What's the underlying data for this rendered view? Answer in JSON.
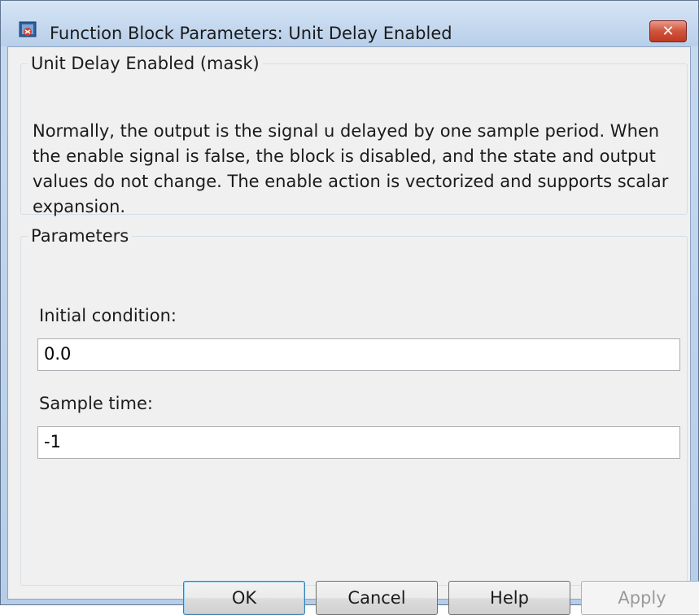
{
  "window": {
    "title": "Function Block Parameters: Unit Delay Enabled",
    "app_icon": "simulink-block-icon",
    "close_label": "✕"
  },
  "description_group": {
    "legend": "Unit Delay Enabled (mask)",
    "text": "Normally, the output is the signal u delayed by one sample period. When the enable signal is false, the block is disabled, and the state and output values do not change.  The enable action is vectorized and supports scalar expansion."
  },
  "parameters_group": {
    "legend": "Parameters",
    "initial_condition": {
      "label": "Initial condition:",
      "value": "0.0"
    },
    "sample_time": {
      "label": "Sample time:",
      "value": "-1"
    }
  },
  "buttons": {
    "ok": "OK",
    "cancel": "Cancel",
    "help": "Help",
    "apply": "Apply"
  }
}
